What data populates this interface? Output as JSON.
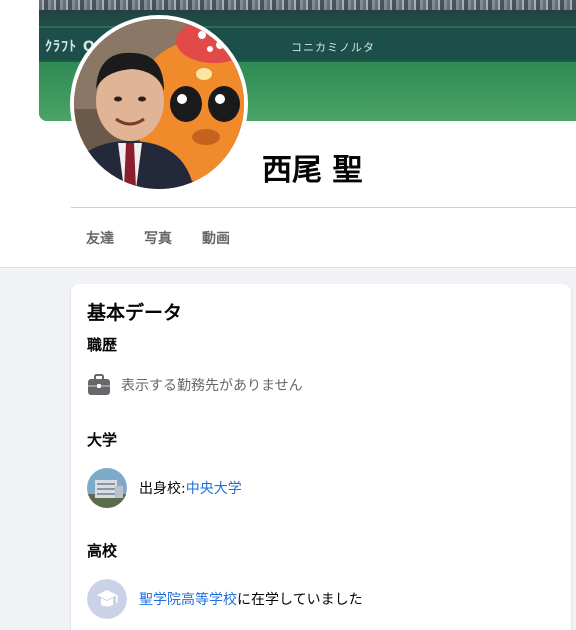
{
  "profile": {
    "name": "西尾 聖"
  },
  "cover": {
    "ad_text_1": "ｸﾗﾌﾄ OIT",
    "ad_text_2": "コニカミノルタ"
  },
  "tabs": [
    {
      "label": "友達"
    },
    {
      "label": "写真"
    },
    {
      "label": "動画"
    }
  ],
  "about": {
    "title": "基本データ",
    "work": {
      "heading": "職歴",
      "text": "表示する勤務先がありません",
      "icon": "briefcase-icon"
    },
    "university": {
      "heading": "大学",
      "prefix": "出身校: ",
      "school": "中央大学"
    },
    "high_school": {
      "heading": "高校",
      "school": "聖学院高等学校",
      "suffix": "に在学していました"
    }
  },
  "colors": {
    "link": "#216fdb",
    "muted": "#65676b",
    "background": "#f0f2f5"
  }
}
